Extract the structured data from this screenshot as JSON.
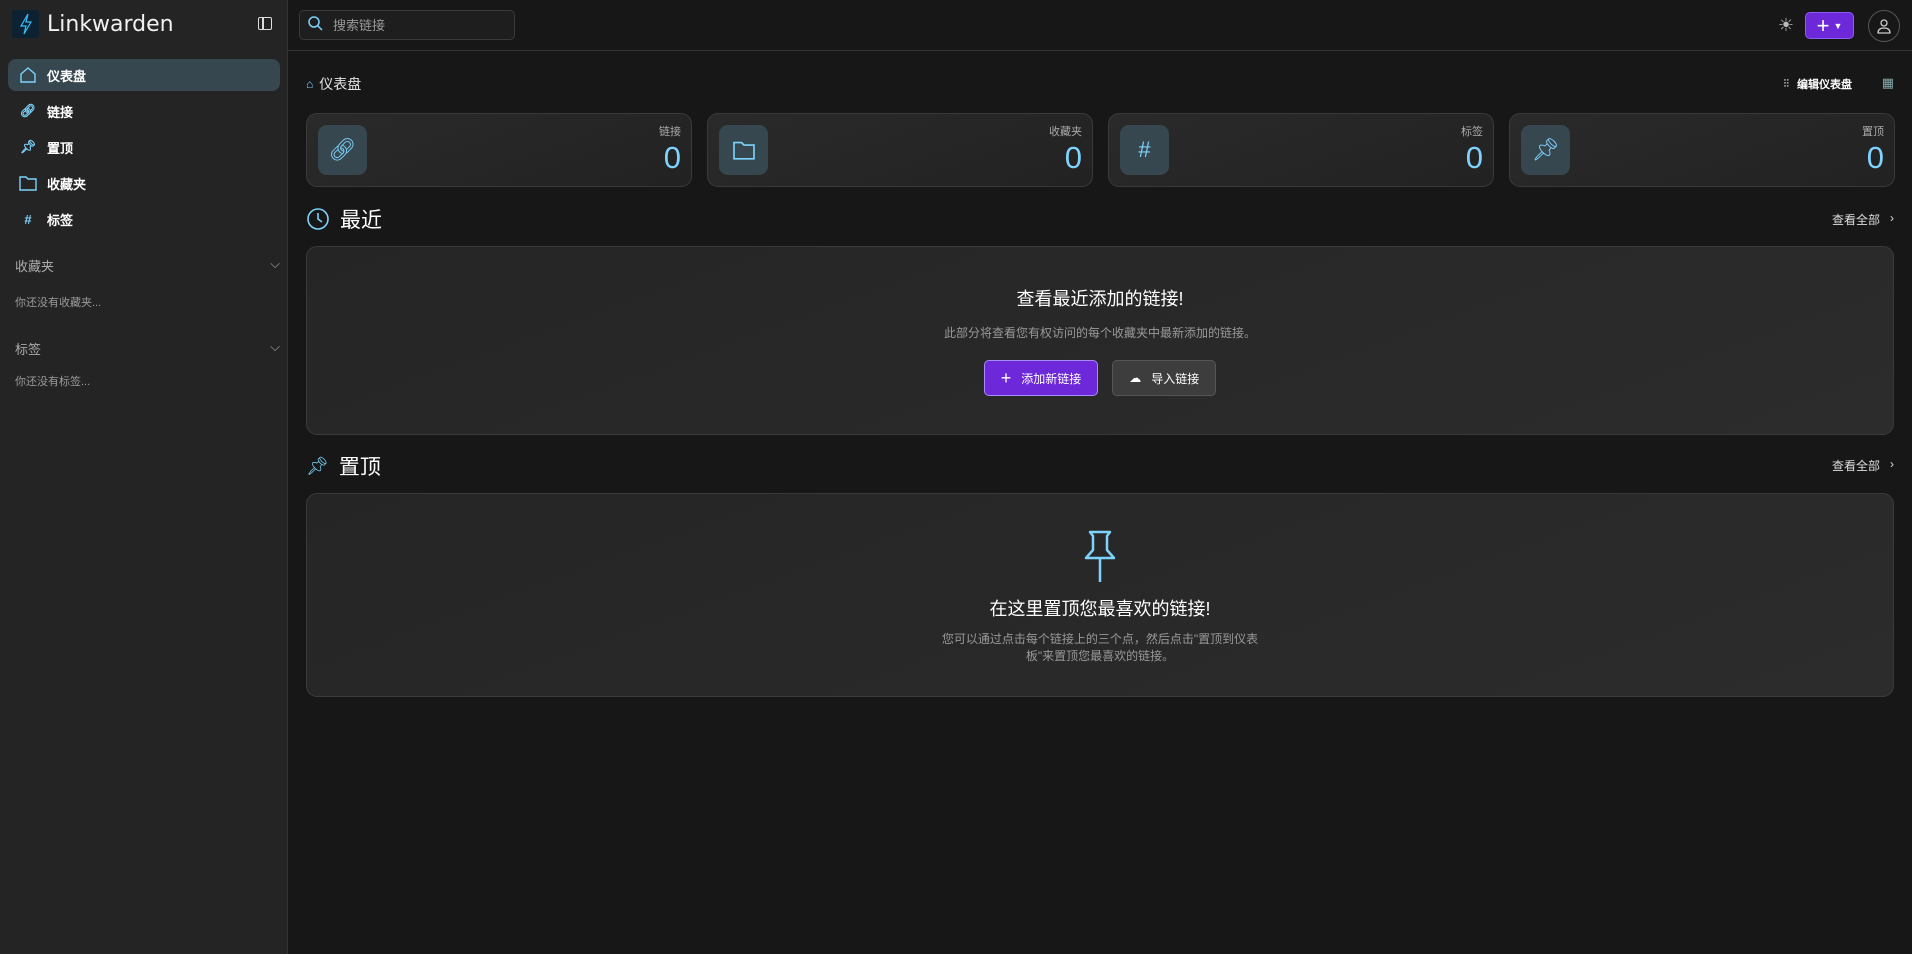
{
  "app": {
    "name": "Linkwarden"
  },
  "sidebar": {
    "nav": [
      {
        "label": "仪表盘",
        "icon": "home-icon"
      },
      {
        "label": "链接",
        "icon": "link-icon"
      },
      {
        "label": "置顶",
        "icon": "pin-icon"
      },
      {
        "label": "收藏夹",
        "icon": "folder-icon"
      },
      {
        "label": "标签",
        "icon": "hash-icon"
      }
    ],
    "collections": {
      "title": "收藏夹",
      "empty": "你还没有收藏夹..."
    },
    "tags": {
      "title": "标签",
      "empty": "你还没有标签..."
    }
  },
  "topbar": {
    "search_placeholder": "搜索链接"
  },
  "main": {
    "breadcrumb": "仪表盘",
    "edit_dashboard": "编辑仪表盘",
    "stats": [
      {
        "label": "链接",
        "value": "0"
      },
      {
        "label": "收藏夹",
        "value": "0"
      },
      {
        "label": "标签",
        "value": "0"
      },
      {
        "label": "置顶",
        "value": "0"
      }
    ],
    "recent": {
      "title": "最近",
      "view_all": "查看全部",
      "empty_title": "查看最近添加的链接!",
      "empty_desc": "此部分将查看您有权访问的每个收藏夹中最新添加的链接。",
      "add_button": "添加新链接",
      "import_button": "导入链接"
    },
    "pinned": {
      "title": "置顶",
      "view_all": "查看全部",
      "empty_title": "在这里置顶您最喜欢的链接!",
      "empty_desc_1": "您可以通过点击每个链接上的三个点，然后点击\"置顶到仪表",
      "empty_desc_2": "板\"来置顶您最喜欢的链接。"
    }
  },
  "colors": {
    "accent": "#6d28d9",
    "icon": "#7dd3fc"
  }
}
